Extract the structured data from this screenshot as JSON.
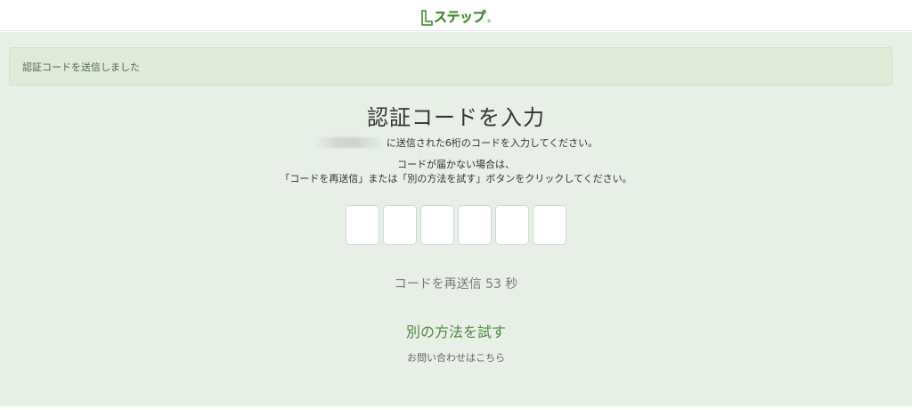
{
  "header": {
    "logo_text": "ステップ",
    "logo_reg": "®"
  },
  "alert": {
    "message": "認証コードを送信しました"
  },
  "main": {
    "title": "認証コードを入力",
    "sent_to_suffix": "に送信された6桁のコードを入力してください。",
    "hint_line1": "コードが届かない場合は、",
    "hint_line2": "「コードを再送信」または「別の方法を試す」ボタンをクリックしてください。",
    "code_digits": [
      "",
      "",
      "",
      "",
      "",
      ""
    ],
    "resend_label": "コードを再送信",
    "resend_seconds": "53",
    "resend_unit": "秒",
    "other_method_label": "別の方法を試す",
    "contact_label": "お問い合わせはこちら"
  },
  "colors": {
    "brand_green": "#4e9a3c",
    "background": "#e7efe7",
    "alert_bg": "#dfebd6"
  }
}
